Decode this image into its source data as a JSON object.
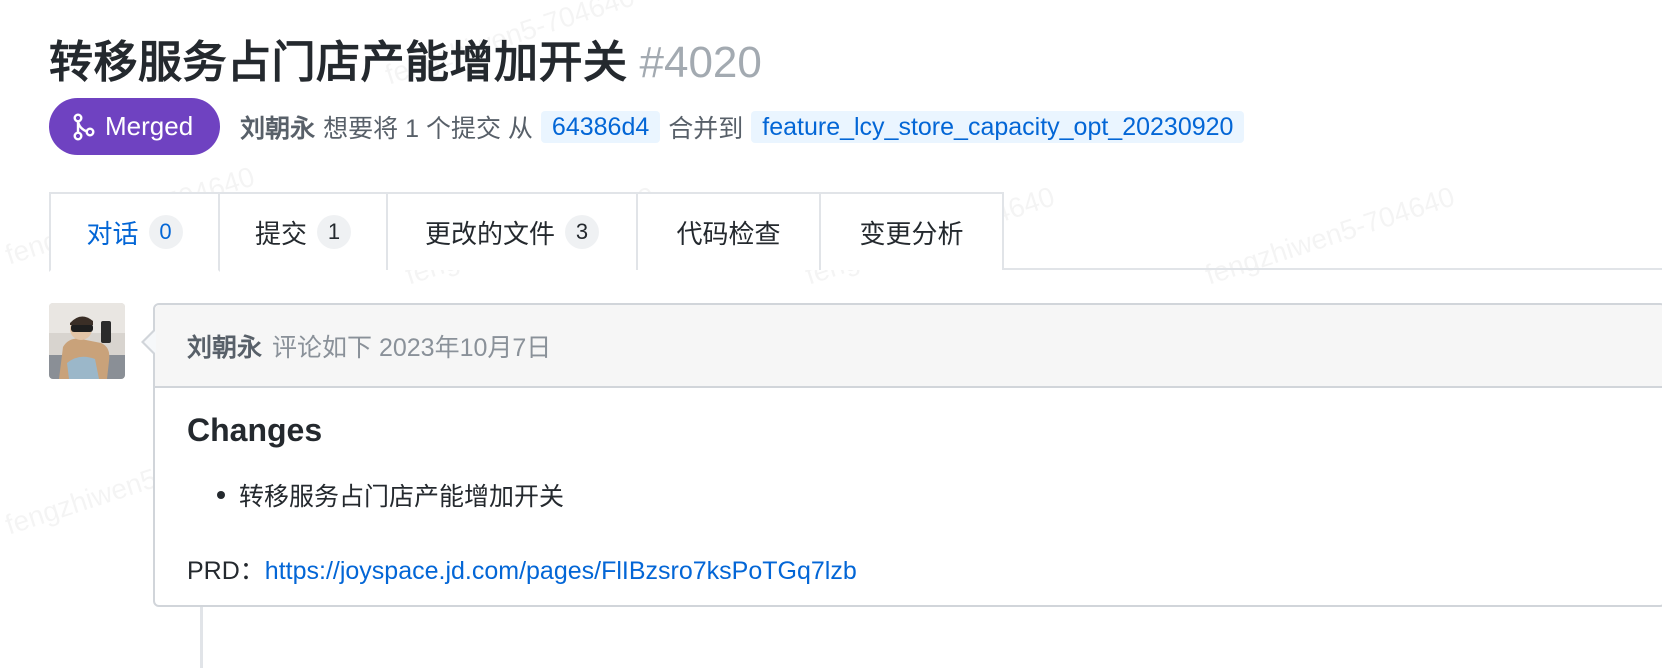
{
  "pr": {
    "title": "转移服务占门店产能增加开关",
    "number": "#4020",
    "status": "Merged",
    "author": "刘朝永",
    "summary_part1": "想要将 1 个提交 从",
    "source_branch": "64386d4",
    "summary_part2": "合并到",
    "target_branch": "feature_lcy_store_capacity_opt_20230920"
  },
  "tabs": [
    {
      "label": "对话",
      "count": "0",
      "active": true
    },
    {
      "label": "提交",
      "count": "1"
    },
    {
      "label": "更改的文件",
      "count": "3"
    },
    {
      "label": "代码检查"
    },
    {
      "label": "变更分析"
    }
  ],
  "comment": {
    "author": "刘朝永",
    "meta": "评论如下 2023年10月7日",
    "heading": "Changes",
    "bullets": [
      "转移服务占门店产能增加开关"
    ],
    "prd_label": "PRD：",
    "prd_link": "https://joyspace.jd.com/pages/FlIBzsro7ksPoTGq7lzb"
  },
  "watermark_text": "fengzhiwen5-704640",
  "colors": {
    "merged": "#6f42c1",
    "link": "#0366d6",
    "branch_bg": "#eaf5ff"
  }
}
